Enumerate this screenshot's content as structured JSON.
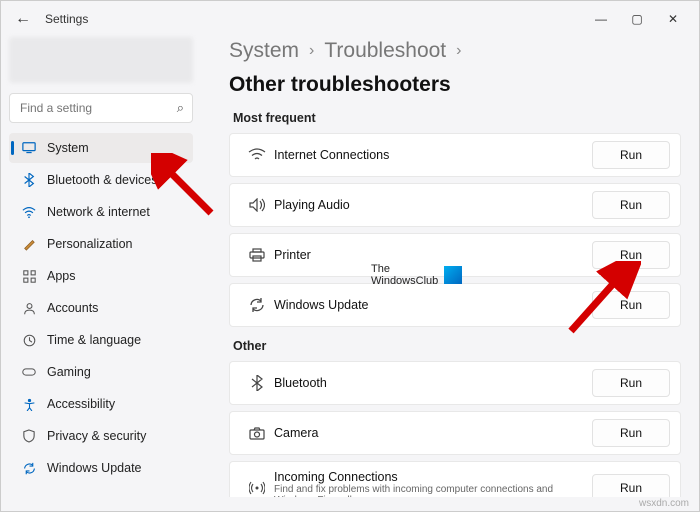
{
  "titlebar": {
    "title": "Settings"
  },
  "search": {
    "placeholder": "Find a setting"
  },
  "sidebar": {
    "items": [
      {
        "label": "System"
      },
      {
        "label": "Bluetooth & devices"
      },
      {
        "label": "Network & internet"
      },
      {
        "label": "Personalization"
      },
      {
        "label": "Apps"
      },
      {
        "label": "Accounts"
      },
      {
        "label": "Time & language"
      },
      {
        "label": "Gaming"
      },
      {
        "label": "Accessibility"
      },
      {
        "label": "Privacy & security"
      },
      {
        "label": "Windows Update"
      }
    ]
  },
  "breadcrumb": {
    "a": "System",
    "b": "Troubleshoot",
    "c": "Other troubleshooters"
  },
  "sections": {
    "frequent_h": "Most frequent",
    "other_h": "Other"
  },
  "troubleshooters": {
    "frequent": [
      {
        "label": "Internet Connections",
        "run": "Run"
      },
      {
        "label": "Playing Audio",
        "run": "Run"
      },
      {
        "label": "Printer",
        "run": "Run"
      },
      {
        "label": "Windows Update",
        "run": "Run"
      }
    ],
    "other": [
      {
        "label": "Bluetooth",
        "run": "Run"
      },
      {
        "label": "Camera",
        "run": "Run"
      },
      {
        "label": "Incoming Connections",
        "sub": "Find and fix problems with incoming computer connections and Windows Firewall.",
        "run": "Run"
      }
    ]
  },
  "watermark": {
    "line1": "The",
    "line2": "WindowsClub"
  },
  "footer": "wsxdn.com"
}
